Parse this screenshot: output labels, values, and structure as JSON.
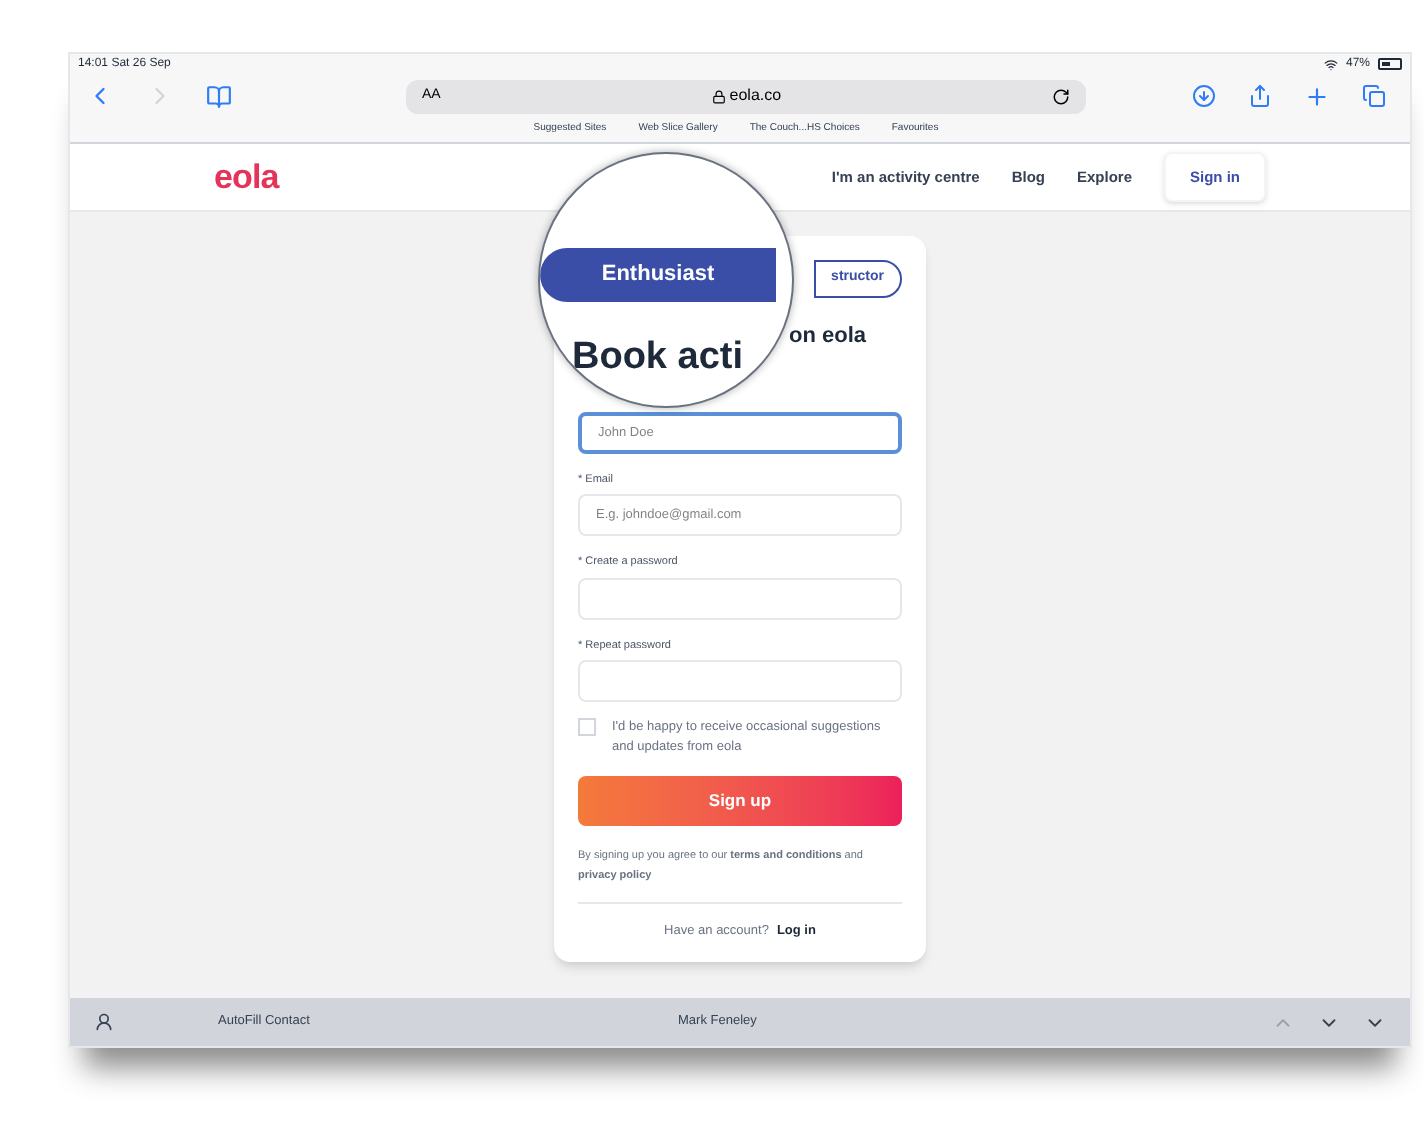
{
  "status_bar": {
    "time": "14:01",
    "date": "Sat 26 Sep",
    "battery": "47%"
  },
  "browser": {
    "text_size": "AA",
    "address": "eola.co",
    "favourites": [
      "Suggested Sites",
      "Web Slice Gallery",
      "The Couch...HS Choices",
      "Favourites"
    ]
  },
  "site_nav": {
    "logo": "eola",
    "links": [
      "I'm an activity centre",
      "Blog",
      "Explore"
    ],
    "sign_in": "Sign in"
  },
  "magnifier": {
    "title": "Book acti"
  },
  "tabs": [
    {
      "label": "Enthusiast",
      "selected": true
    },
    {
      "label": "structor",
      "selected": false
    }
  ],
  "title_rest": "on eola",
  "fields": [
    {
      "placeholder": "John Doe",
      "focused": true
    },
    {
      "label": "* Email",
      "placeholder": "E.g. johndoe@gmail.com",
      "focused": false
    },
    {
      "label": "* Create a password",
      "focused": false
    },
    {
      "label": "* Repeat password",
      "focused": false
    }
  ],
  "consent": {
    "text": "I'd be happy to receive occasional suggestions and updates from eola",
    "checked": false
  },
  "sign_up": "Sign up",
  "terms": "By signing up you agree to our **terms and conditions** and **privacy policy**",
  "login": {
    "text": "Have an account?",
    "link": "Log in"
  },
  "autofill": {
    "label": "AutoFill Contact",
    "contact": "Mark Feneley"
  }
}
